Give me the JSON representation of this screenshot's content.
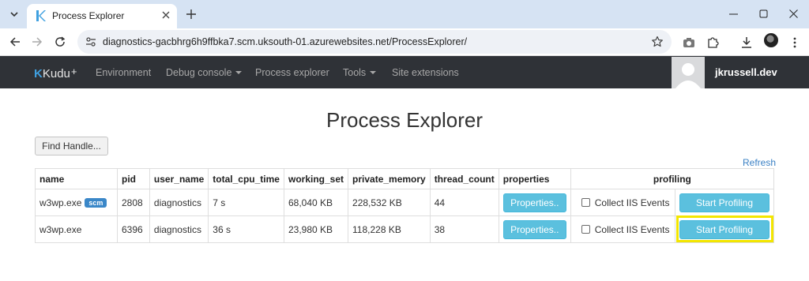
{
  "browser": {
    "tab_title": "Process Explorer",
    "url": "diagnostics-gacbhrg6h9ffbka7.scm.uksouth-01.azurewebsites.net/ProcessExplorer/"
  },
  "kudu": {
    "brand": "Kudu",
    "brand_suffix": "+",
    "nav": [
      {
        "label": "Environment"
      },
      {
        "label": "Debug console"
      },
      {
        "label": "Process explorer"
      },
      {
        "label": "Tools"
      },
      {
        "label": "Site extensions"
      }
    ],
    "user": "jkrussell.dev"
  },
  "page": {
    "title": "Process Explorer",
    "find_handle": "Find Handle...",
    "refresh": "Refresh",
    "columns": [
      "name",
      "pid",
      "user_name",
      "total_cpu_time",
      "working_set",
      "private_memory",
      "thread_count",
      "properties",
      "profiling"
    ],
    "rows": [
      {
        "name": "w3wp.exe",
        "badge": "scm",
        "pid": "2808",
        "user_name": "diagnostics",
        "total_cpu_time": "7 s",
        "working_set": "68,040 KB",
        "private_memory": "228,532 KB",
        "thread_count": "44",
        "properties_btn": "Properties..",
        "iis_label": "Collect IIS Events",
        "profile_btn": "Start Profiling"
      },
      {
        "name": "w3wp.exe",
        "badge": "",
        "pid": "6396",
        "user_name": "diagnostics",
        "total_cpu_time": "36 s",
        "working_set": "23,980 KB",
        "private_memory": "118,228 KB",
        "thread_count": "38",
        "properties_btn": "Properties..",
        "iis_label": "Collect IIS Events",
        "profile_btn": "Start Profiling"
      }
    ]
  },
  "colors": {
    "navbar": "#2f3237",
    "accent_button": "#5bc0de",
    "badge": "#3a87c8",
    "highlight": "#f3e600",
    "link": "#3a80c4"
  }
}
